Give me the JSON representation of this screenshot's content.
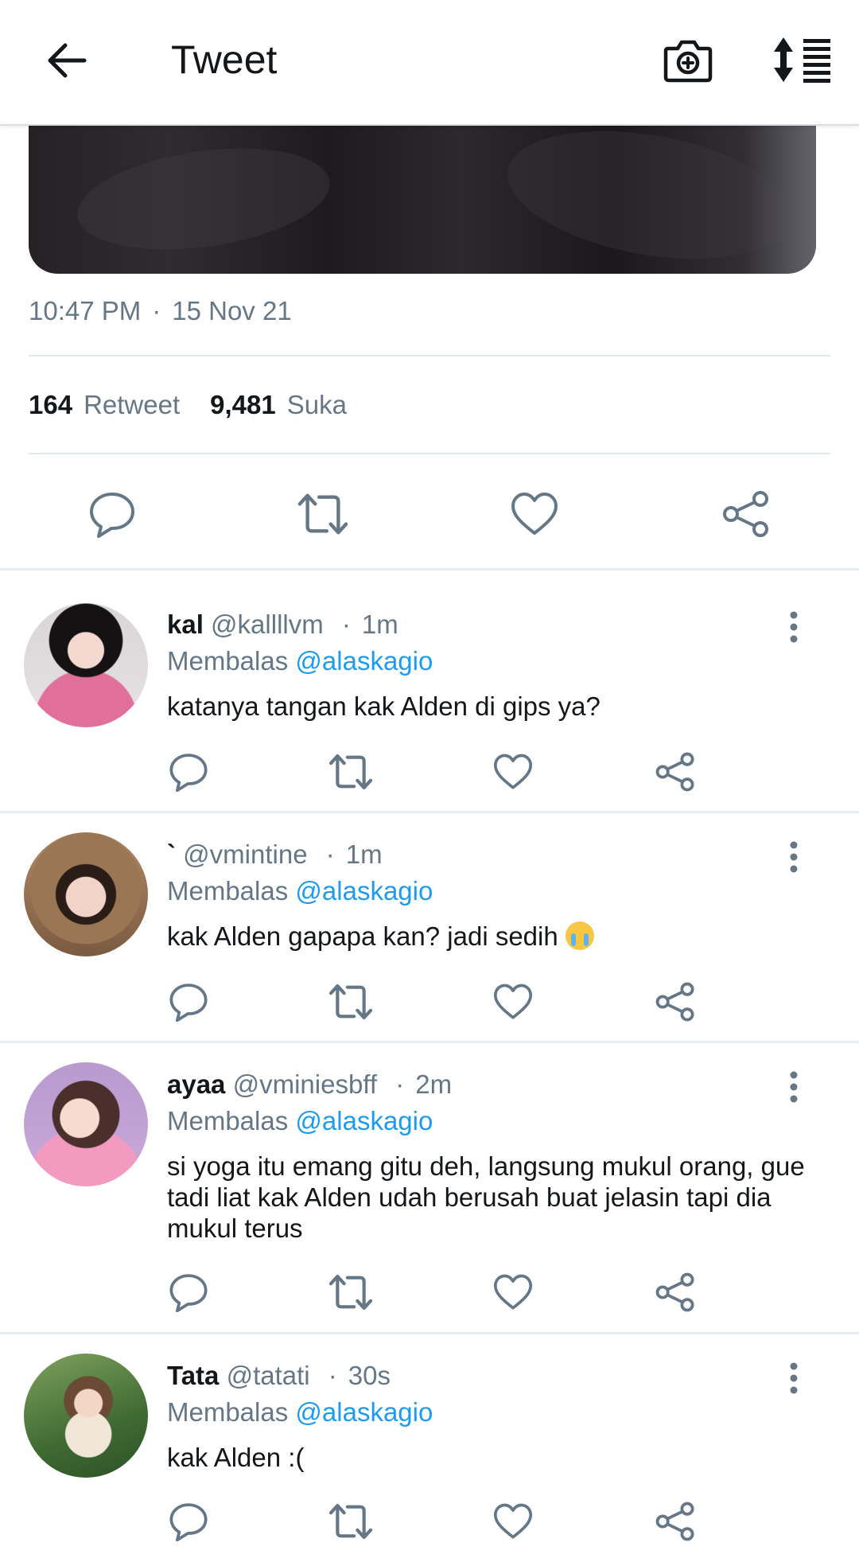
{
  "topbar": {
    "title": "Tweet",
    "back_icon": "arrow-left-icon",
    "camera_icon": "camera-plus-icon",
    "sort_icon": "sort-order-icon"
  },
  "tweet": {
    "time": "10:47 PM",
    "separator": "·",
    "date": "15 Nov 21",
    "retweet_count": "164",
    "retweet_label": "Retweet",
    "like_count": "9,481",
    "like_label": "Suka"
  },
  "replies": [
    {
      "name": "kal",
      "handle": "@kallllvm",
      "separator": "·",
      "time": "1m",
      "replying_label": "Membalas",
      "replying_to": "@alaskagio",
      "text": "katanya tangan kak Alden di gips ya?"
    },
    {
      "name": "`",
      "handle": "@vmintine",
      "separator": "·",
      "time": "1m",
      "replying_label": "Membalas",
      "replying_to": "@alaskagio",
      "text": "kak Alden gapapa kan? jadi sedih"
    },
    {
      "name": "ayaa",
      "handle": "@vminiesbff",
      "separator": "·",
      "time": "2m",
      "replying_label": "Membalas",
      "replying_to": "@alaskagio",
      "text": "si yoga itu emang gitu deh, langsung mukul orang, gue tadi liat kak Alden udah berusah buat jelasin tapi dia mukul terus"
    },
    {
      "name": "Tata",
      "handle": "@tatati",
      "separator": "·",
      "time": "30s",
      "replying_label": "Membalas",
      "replying_to": "@alaskagio",
      "text": "kak Alden :("
    }
  ],
  "colors": {
    "accent": "#1d9bf0",
    "secondary_text": "#657786",
    "primary_text": "#14171a",
    "divider": "#e1e8ed"
  }
}
